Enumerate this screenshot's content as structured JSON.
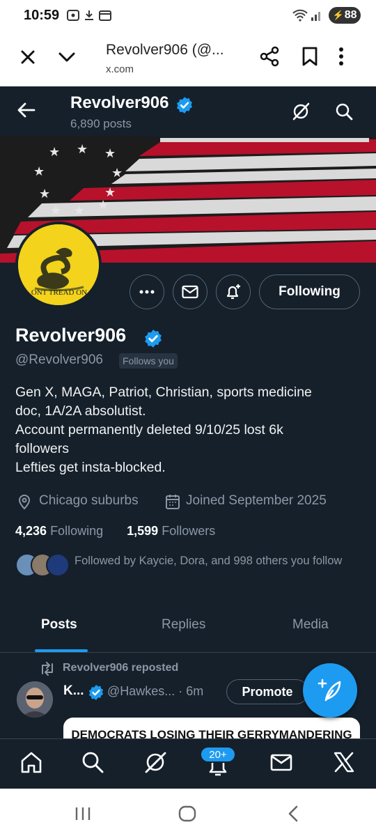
{
  "status_bar": {
    "time": "10:59",
    "battery": "88"
  },
  "browser": {
    "title": "Revolver906 (@...",
    "url": "x.com"
  },
  "header": {
    "name": "Revolver906",
    "posts": "6,890 posts"
  },
  "avatar": {
    "text": "ONT TREAD ON"
  },
  "actions": {
    "following_label": "Following"
  },
  "profile": {
    "name": "Revolver906",
    "handle": "@Revolver906",
    "follows_you": "Follows you",
    "bio": [
      "Gen X, MAGA, Patriot, Christian, sports medicine",
      "doc, 1A/2A absolutist.",
      "Account permanently deleted 9/10/25 lost 6k",
      "followers",
      "Lefties get insta-blocked."
    ],
    "location": "Chicago suburbs",
    "joined": "Joined September 2025",
    "following_count": "4,236",
    "following_label": "Following",
    "followers_count": "1,599",
    "followers_label": "Followers",
    "followed_by": "Followed by Kaycie, Dora, and 998 others you follow"
  },
  "tabs": [
    {
      "label": "Posts"
    },
    {
      "label": "Replies"
    },
    {
      "label": "Media"
    }
  ],
  "post": {
    "repost_text": "Revolver906 reposted",
    "author_name": "K...",
    "handle_time": "@Hawkes... · 6m",
    "promote_label": "Promote",
    "media_headline": "DEMOCRATS LOSING THEIR GERRYMANDERING"
  },
  "bottom_nav": {
    "notifications_badge": "20+"
  },
  "colors": {
    "background": "#15202b",
    "accent": "#1d9bf0",
    "muted": "#8b98a5"
  }
}
